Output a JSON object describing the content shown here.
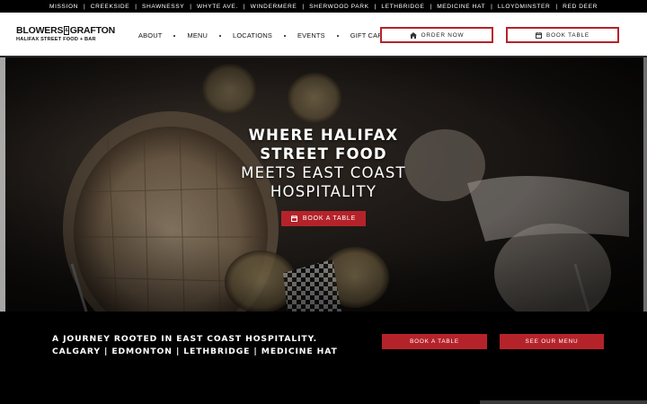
{
  "locations": [
    "Mission",
    "Creekside",
    "Shawnessy",
    "Whyte Ave.",
    "Windermere",
    "Sherwood Park",
    "Lethbridge",
    "Medicine Hat",
    "Lloydminster",
    "Red Deer"
  ],
  "location_separator": "|",
  "logo": {
    "word_left": "BLOWERS",
    "amp": "&",
    "word_right": "GRAFTON",
    "tagline": "HALIFAX STREET FOOD + BAR"
  },
  "nav": {
    "items": [
      "About",
      "Menu",
      "Locations",
      "Events",
      "Gift Cards"
    ]
  },
  "header_buttons": {
    "order_label": "Order Now",
    "book_label": "Book Table"
  },
  "hero": {
    "title_line1": "WHERE HALIFAX",
    "title_line2": "STREET FOOD",
    "title_line3": "MEETS EAST COAST",
    "title_line4": "HOSPITALITY",
    "button_label": "Book a Table"
  },
  "band": {
    "line1": "A JOURNEY ROOTED IN EAST COAST HOSPITALITY.",
    "line2": "CALGARY | EDMONTON | LETHBRIDGE | MEDICINE HAT",
    "book_label": "Book a Table",
    "menu_label": "See our Menu"
  },
  "colors": {
    "accent_red": "#b5232a",
    "top_strip": "#000000",
    "header_bg": "#ffffff"
  },
  "icons": {
    "order": "home-icon",
    "book": "calendar-icon"
  }
}
